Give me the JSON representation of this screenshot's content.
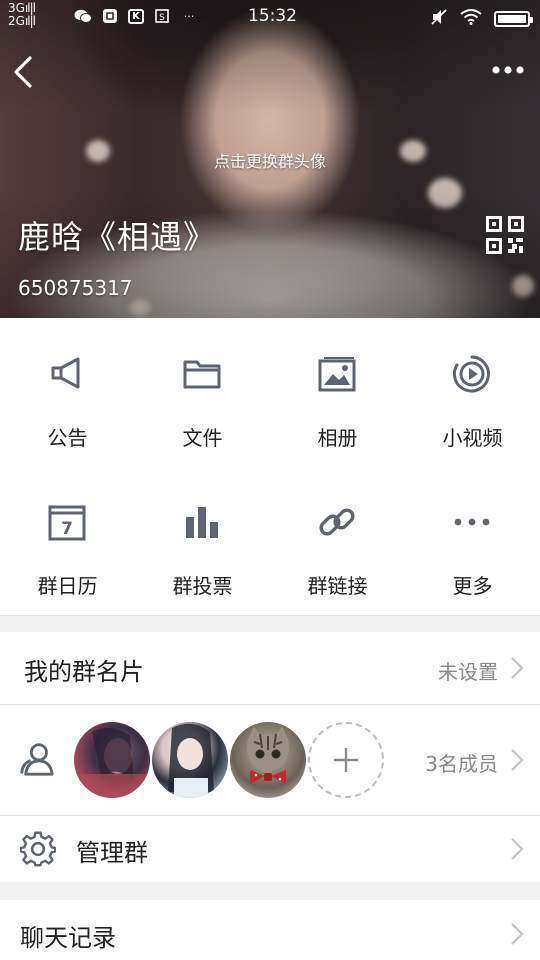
{
  "status_bar": {
    "network_top": "3G",
    "network_bottom": "2G",
    "time": "15:32",
    "more_glyph": "···",
    "app_icons": [
      "wechat-icon",
      "app-box-icon",
      "k-app-icon",
      "screenshot-icon"
    ],
    "right_icons": [
      "mute-icon",
      "wifi-icon",
      "battery-icon"
    ]
  },
  "header": {
    "change_avatar_hint": "点击更换群头像",
    "group_name": "鹿晗《相遇》",
    "group_id": "650875317"
  },
  "grid": {
    "items": [
      {
        "label": "公告",
        "icon": "megaphone-icon"
      },
      {
        "label": "文件",
        "icon": "folder-icon"
      },
      {
        "label": "相册",
        "icon": "album-icon"
      },
      {
        "label": "小视频",
        "icon": "video-icon"
      },
      {
        "label": "群日历",
        "icon": "calendar-icon",
        "calendar_day": "7"
      },
      {
        "label": "群投票",
        "icon": "poll-icon"
      },
      {
        "label": "群链接",
        "icon": "link-icon"
      },
      {
        "label": "更多",
        "icon": "more-icon"
      }
    ]
  },
  "card": {
    "title": "我的群名片",
    "value": "未设置"
  },
  "members": {
    "count_label": "3名成员"
  },
  "manage": {
    "title": "管理群"
  },
  "chat_history": {
    "title": "聊天记录"
  },
  "colors": {
    "icon": "#5e6470",
    "chevron": "#c3c3c3",
    "secondary_text": "#8a8a8a"
  }
}
